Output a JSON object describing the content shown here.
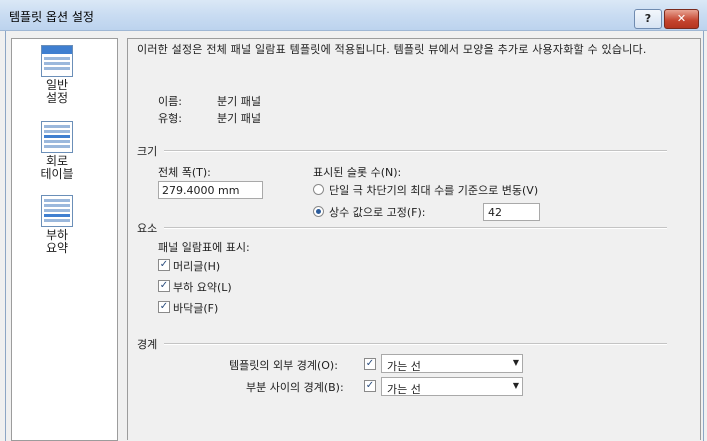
{
  "window": {
    "title": "템플릿 옵션 설정",
    "help_label": "?",
    "close_label": "✕"
  },
  "sidebar": {
    "items": [
      {
        "label": "일반\n설정",
        "icon": "general-settings-icon"
      },
      {
        "label": "회로\n테이블",
        "icon": "circuit-table-icon"
      },
      {
        "label": "부하\n요약",
        "icon": "load-summary-icon"
      }
    ]
  },
  "main": {
    "description": "이러한 설정은 전체 패널 일람표 템플릿에 적용됩니다. 템플릿 뷰에서 모양을 추가로 사용자화할 수 있습니다.",
    "name_label": "이름:",
    "name_value": "분기 패널",
    "type_label": "유형:",
    "type_value": "분기 패널",
    "size": {
      "section_label": "크기",
      "total_width_label": "전체 폭(T):",
      "total_width_value": "279.4000 mm",
      "slots_label": "표시된 슬롯 수(N):",
      "option_variable": "단일 극 차단기의 최대 수를 기준으로 변동(V)",
      "option_fixed": "상수 값으로 고정(F):",
      "fixed_value": "42",
      "selected_option": "fixed"
    },
    "elements": {
      "section_label": "요소",
      "show_label": "패널 일람표에 표시:",
      "header_label": "머리글(H)",
      "header_checked": true,
      "load_summary_label": "부하 요약(L)",
      "load_summary_checked": true,
      "footer_label": "바닥글(F)",
      "footer_checked": true
    },
    "borders": {
      "section_label": "경계",
      "outer_label": "템플릿의 외부 경계(O):",
      "outer_checked": true,
      "outer_value": "가는 선",
      "between_label": "부분 사이의 경계(B):",
      "between_checked": true,
      "between_value": "가는 선"
    }
  }
}
